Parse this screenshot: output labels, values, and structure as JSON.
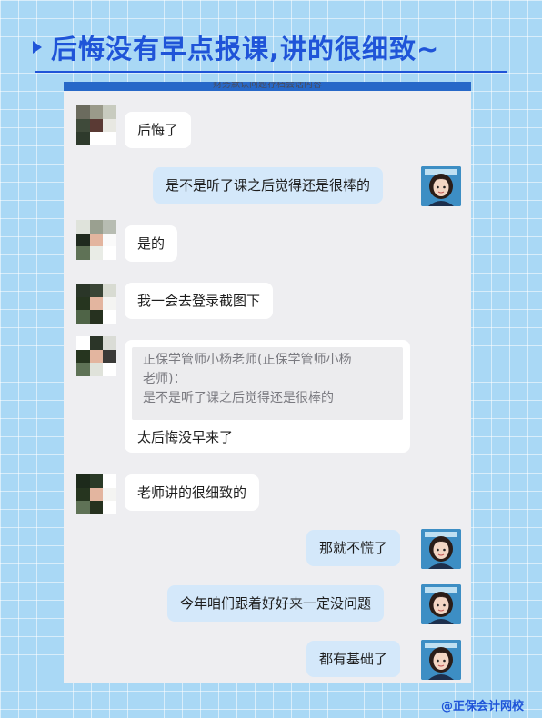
{
  "header": {
    "title": "后悔没有早点报课,讲的很细致~"
  },
  "chat": {
    "top_banner": "财务默认问题存档会话内容",
    "messages": [
      {
        "side": "left",
        "text": "后悔了"
      },
      {
        "side": "right",
        "text": "是不是听了课之后觉得还是很棒的"
      },
      {
        "side": "left",
        "text": "是的"
      },
      {
        "side": "left",
        "text": "我一会去登录截图下"
      },
      {
        "side": "left",
        "quote": "正保学管师小杨老师(正保学管师小杨老师)：是不是听了课之后觉得还是很棒的",
        "text": "太后悔没早来了"
      },
      {
        "side": "left",
        "text": "老师讲的很细致的"
      },
      {
        "side": "right",
        "text": "那就不慌了"
      },
      {
        "side": "right",
        "text": "今年咱们跟着好好来一定没问题"
      },
      {
        "side": "right",
        "text": "都有基础了"
      }
    ],
    "quote_lines": [
      "正保学管师小杨老师(正保学管师小杨",
      "老师)：",
      "是不是听了课之后觉得还是很棒的"
    ]
  },
  "footer": {
    "watermark": "@正保会计网校"
  },
  "colors": {
    "accent": "#1f54d8",
    "self_bubble": "#d4e8fa",
    "other_bubble": "#ffffff",
    "panel": "#eeeef1"
  },
  "icons": {
    "user_avatar": "pixelated-avatar",
    "teacher_avatar": "cartoon-teacher-avatar"
  }
}
